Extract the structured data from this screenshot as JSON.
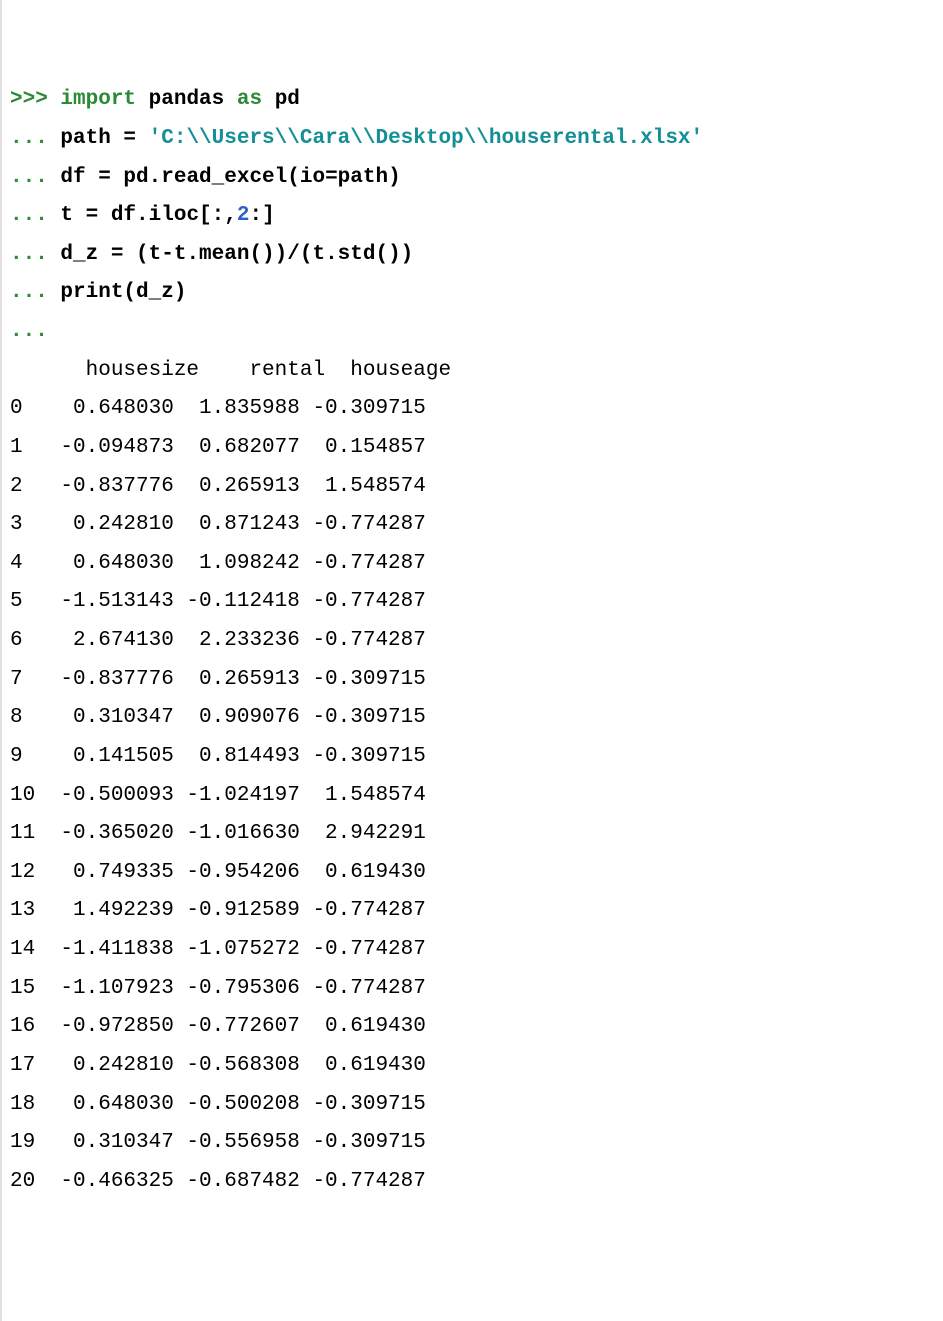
{
  "code": {
    "prompt": ">>>",
    "cont": "...",
    "kw_import": "import",
    "kw_as": "as",
    "mod": "pandas",
    "alias": "pd",
    "l2a": "path = ",
    "l2b": "'C:\\\\Users\\\\Cara\\\\Desktop\\\\houserental.xlsx'",
    "l3": "df = pd.read_excel(io=path)",
    "l4a": "t = df.iloc[:,",
    "l4n": "2",
    "l4b": ":]",
    "l5": "d_z = (t-t.mean())/(t.std())",
    "l6": "print(d_z)"
  },
  "chart_data": {
    "type": "table",
    "columns": [
      "housesize",
      "rental",
      "houseage"
    ],
    "index": [
      0,
      1,
      2,
      3,
      4,
      5,
      6,
      7,
      8,
      9,
      10,
      11,
      12,
      13,
      14,
      15,
      16,
      17,
      18,
      19,
      20
    ],
    "rows": [
      [
        0.64803,
        1.835988,
        -0.309715
      ],
      [
        -0.094873,
        0.682077,
        0.154857
      ],
      [
        -0.837776,
        0.265913,
        1.548574
      ],
      [
        0.24281,
        0.871243,
        -0.774287
      ],
      [
        0.64803,
        1.098242,
        -0.774287
      ],
      [
        -1.513143,
        -0.112418,
        -0.774287
      ],
      [
        2.67413,
        2.233236,
        -0.774287
      ],
      [
        -0.837776,
        0.265913,
        -0.309715
      ],
      [
        0.310347,
        0.909076,
        -0.309715
      ],
      [
        0.141505,
        0.814493,
        -0.309715
      ],
      [
        -0.500093,
        -1.024197,
        1.548574
      ],
      [
        -0.36502,
        -1.01663,
        2.942291
      ],
      [
        0.749335,
        -0.954206,
        0.61943
      ],
      [
        1.492239,
        -0.912589,
        -0.774287
      ],
      [
        -1.411838,
        -1.075272,
        -0.774287
      ],
      [
        -1.107923,
        -0.795306,
        -0.774287
      ],
      [
        -0.97285,
        -0.772607,
        0.61943
      ],
      [
        0.24281,
        -0.568308,
        0.61943
      ],
      [
        0.64803,
        -0.500208,
        -0.309715
      ],
      [
        0.310347,
        -0.556958,
        -0.309715
      ],
      [
        -0.466325,
        -0.687482,
        -0.774287
      ]
    ]
  }
}
